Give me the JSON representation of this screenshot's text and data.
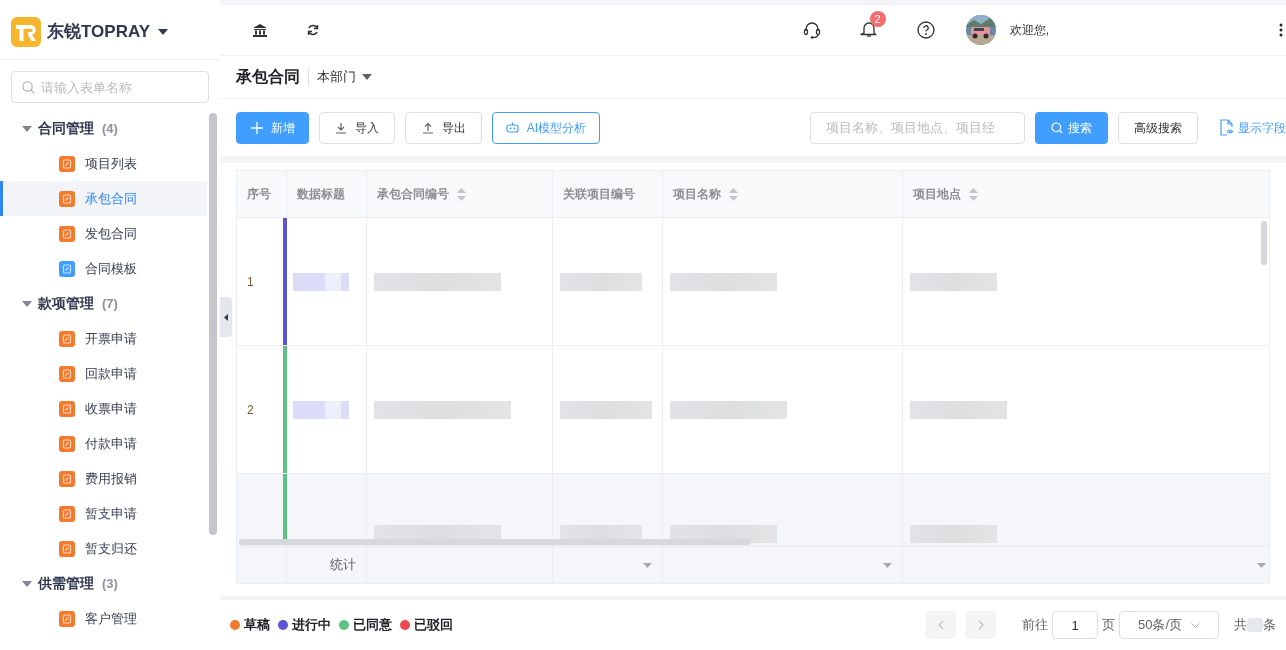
{
  "brand": {
    "name": "东锐TOPRAY"
  },
  "sidebar": {
    "search": {
      "placeholder": "请输入表单名称"
    },
    "groups": [
      {
        "label": "合同管理",
        "count": "(4)",
        "expanded": true,
        "children": [
          {
            "label": "项目列表",
            "color": "#f5792a",
            "selected": false
          },
          {
            "label": "承包合同",
            "color": "#f5792a",
            "selected": true
          },
          {
            "label": "发包合同",
            "color": "#f5792a",
            "selected": false
          },
          {
            "label": "合同模板",
            "color": "#409eff",
            "selected": false
          }
        ]
      },
      {
        "label": "款项管理",
        "count": "(7)",
        "expanded": true,
        "children": [
          {
            "label": "开票申请",
            "color": "#f5792a",
            "selected": false
          },
          {
            "label": "回款申请",
            "color": "#f5792a",
            "selected": false
          },
          {
            "label": "收票申请",
            "color": "#f5792a",
            "selected": false
          },
          {
            "label": "付款申请",
            "color": "#f5792a",
            "selected": false
          },
          {
            "label": "费用报销",
            "color": "#f5792a",
            "selected": false
          },
          {
            "label": "暂支申请",
            "color": "#f5792a",
            "selected": false
          },
          {
            "label": "暂支归还",
            "color": "#f5792a",
            "selected": false
          }
        ]
      },
      {
        "label": "供需管理",
        "count": "(3)",
        "expanded": true,
        "children": [
          {
            "label": "客户管理",
            "color": "#f5792a",
            "selected": false
          }
        ]
      }
    ]
  },
  "topbar": {
    "notifications": "2",
    "welcome": "欢迎您,"
  },
  "page": {
    "title": "承包合同",
    "scope": "本部门"
  },
  "toolbar": {
    "buttons": [
      {
        "label": "新增",
        "kind": "primary"
      },
      {
        "label": "导入",
        "kind": "import"
      },
      {
        "label": "导出",
        "kind": "export"
      },
      {
        "label": "AI模型分析",
        "kind": "ai"
      }
    ],
    "search": {
      "placeholder": "项目名称、项目地点、项目经"
    },
    "search_button": "搜索",
    "advanced": "高级搜索",
    "fields": "显示字段"
  },
  "table": {
    "columns": [
      {
        "label": "序号",
        "sortable": false
      },
      {
        "label": "数据标题",
        "sortable": false
      },
      {
        "label": "承包合同编号",
        "sortable": true
      },
      {
        "label": "关联项目编号",
        "sortable": false
      },
      {
        "label": "项目名称",
        "sortable": true
      },
      {
        "label": "项目地点",
        "sortable": true
      }
    ],
    "rows": [
      {
        "index": "1",
        "color": "#5b54d6",
        "highlighted": false
      },
      {
        "index": "2",
        "color": "#5ec285",
        "highlighted": false
      },
      {
        "color": "#5ec285",
        "highlighted": true
      }
    ],
    "summary_label": "统计"
  },
  "legend": [
    {
      "label": "草稿",
      "color": "#f5792a"
    },
    {
      "label": "进行中",
      "color": "#5b54d6"
    },
    {
      "label": "已同意",
      "color": "#5ec285"
    },
    {
      "label": "已驳回",
      "color": "#f0474f"
    }
  ],
  "pagination": {
    "goto": "前往",
    "page": "1",
    "page_unit": "页",
    "page_size": "50条/页",
    "total_prefix": "共",
    "total_suffix": "条"
  }
}
